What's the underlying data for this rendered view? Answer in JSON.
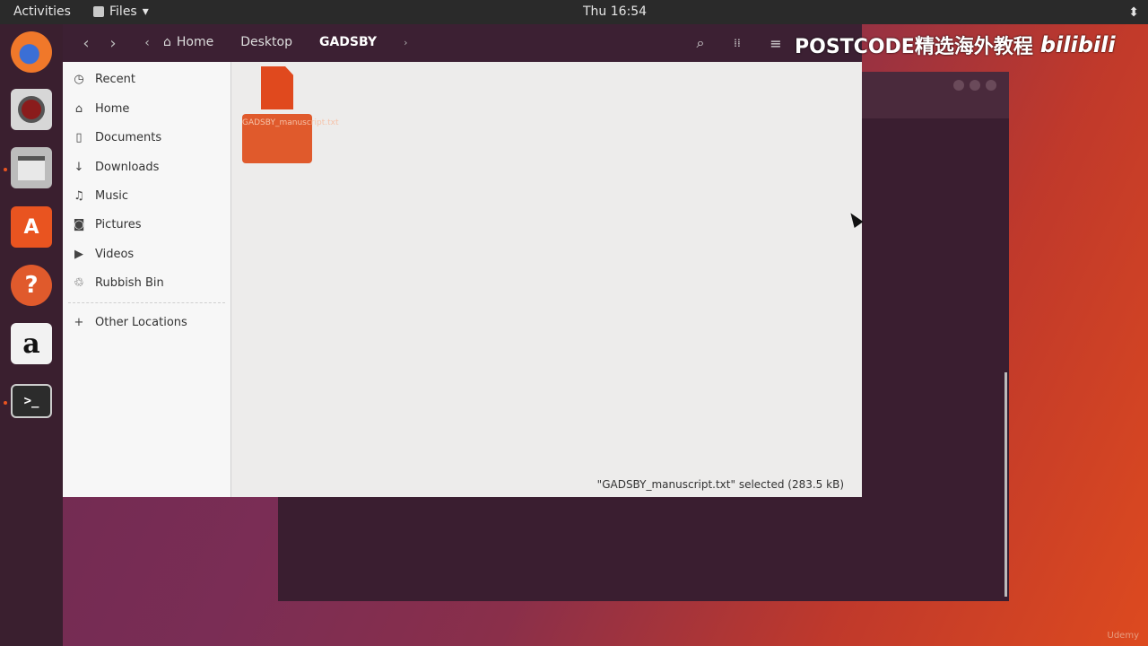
{
  "topbar": {
    "activities": "Activities",
    "app_name": "Files",
    "app_menu_arrow": "▾",
    "clock": "Thu 16:54",
    "network_glyph": "⬍"
  },
  "dock": {
    "items": [
      "Firefox",
      "Rhythmbox",
      "Files",
      "Ubuntu Software",
      "Help",
      "Amazon",
      "Terminal"
    ],
    "amazon_glyph": "a",
    "help_glyph": "?",
    "software_glyph": "A",
    "terminal_glyph": ">_"
  },
  "headerbar": {
    "back": "‹",
    "forward": "›",
    "left_arrow": "‹",
    "breadcrumbs": [
      "Home",
      "Desktop",
      "GADSBY"
    ],
    "right_arrow": "›",
    "icons": [
      "search-icon",
      "view-icon",
      "menu-icon"
    ],
    "search_glyph": "⌕",
    "view_glyph": "⁞⁞",
    "menu_glyph": "≡"
  },
  "sidebar": {
    "items": [
      {
        "label": "Recent",
        "glyph": "◷"
      },
      {
        "label": "Home",
        "glyph": "⌂"
      },
      {
        "label": "Documents",
        "glyph": "▯"
      },
      {
        "label": "Downloads",
        "glyph": "↓"
      },
      {
        "label": "Music",
        "glyph": "♫"
      },
      {
        "label": "Pictures",
        "glyph": "◙"
      },
      {
        "label": "Videos",
        "glyph": "▶"
      },
      {
        "label": "Rubbish Bin",
        "glyph": "♲"
      }
    ],
    "other": {
      "label": "Other Locations",
      "glyph": "+"
    }
  },
  "content": {
    "file_label": "GADSBY_manuscript.txt",
    "status": "\"GADSBY_manuscript.txt\" selected (283.5 kB)"
  },
  "watermark": {
    "text": "POSTCODE精选海外教程",
    "brand": "bilibili"
  },
  "corner": "Udemy",
  "colors": {
    "accent": "#e95420",
    "dock_bg": "#3a1f2f",
    "topbar_bg": "#2a2a2a"
  }
}
